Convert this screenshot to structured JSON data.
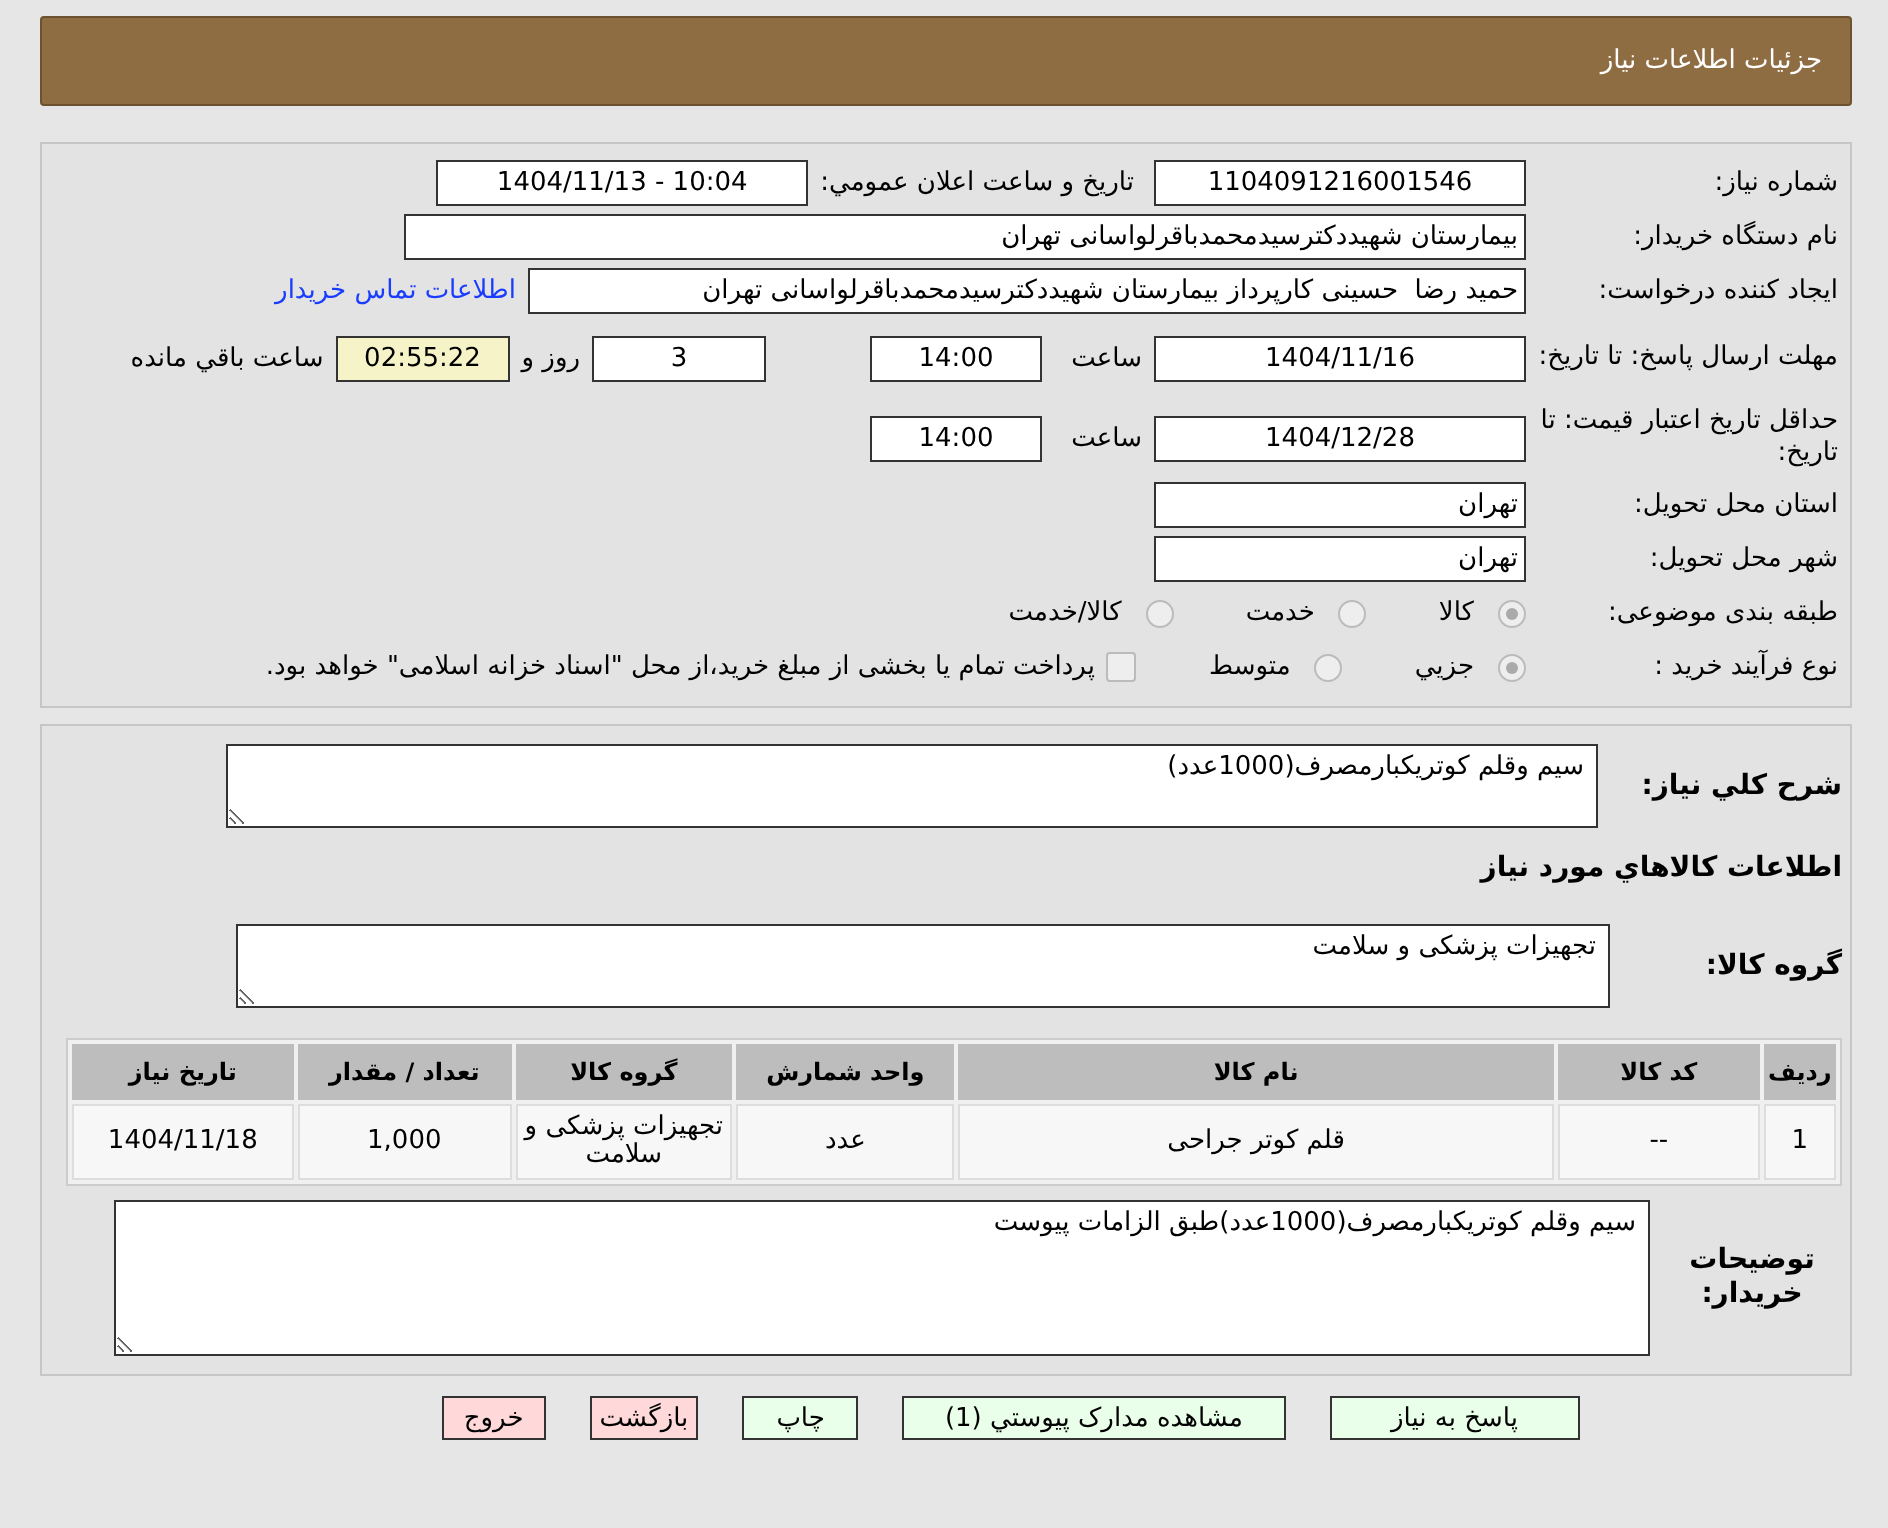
{
  "header": {
    "title": "جزئیات اطلاعات نیاز"
  },
  "need_number": {
    "label": "شماره نیاز:",
    "value": "1104091216001546"
  },
  "announce": {
    "label": "تاریخ و ساعت اعلان عمومي:",
    "value": "1404/11/13 - 10:04"
  },
  "buyer_org": {
    "label": "نام دستگاه خریدار:",
    "value": "بیمارستان شهیددکترسیدمحمدباقرلواسانی تهران"
  },
  "requester": {
    "label": "ایجاد کننده درخواست:",
    "value": "حمید رضا  حسینی کارپرداز بیمارستان شهیددکترسیدمحمدباقرلواسانی تهران",
    "link": "اطلاعات تماس خریدار"
  },
  "deadline": {
    "label": "مهلت ارسال پاسخ: تا تاریخ:",
    "date": "1404/11/16",
    "time_label": "ساعت",
    "time": "14:00",
    "days": "3",
    "days_label": "روز و",
    "remaining": "02:55:22",
    "remaining_label": "ساعت باقي مانده"
  },
  "validity": {
    "label": "حداقل تاریخ اعتبار قیمت: تا تاریخ:",
    "date": "1404/12/28",
    "time_label": "ساعت",
    "time": "14:00"
  },
  "province": {
    "label": "استان محل تحویل:",
    "value": "تهران"
  },
  "city": {
    "label": "شهر محل تحویل:",
    "value": "تهران"
  },
  "category": {
    "label": "طبقه بندی موضوعی:",
    "options": [
      {
        "label": "کالا",
        "selected": true
      },
      {
        "label": "خدمت",
        "selected": false
      },
      {
        "label": "کالا/خدمت",
        "selected": false
      }
    ]
  },
  "process": {
    "label": "نوع فرآیند خرید :",
    "options": [
      {
        "label": "جزيي",
        "selected": true
      },
      {
        "label": "متوسط",
        "selected": false
      }
    ],
    "payment_checkbox": {
      "checked": false,
      "label": "پرداخت تمام یا بخشی از مبلغ خرید،از محل \"اسناد خزانه اسلامی\" خواهد بود."
    }
  },
  "summary": {
    "label": "شرح کلي نیاز:",
    "value": "سیم وقلم کوتریکبارمصرف(1000عدد)"
  },
  "goods_heading": "اطلاعات کالاهاي مورد نیاز",
  "goods_group": {
    "label": "گروه کالا:",
    "value": "تجهیزات پزشکی و سلامت"
  },
  "table": {
    "columns": [
      "ردیف",
      "کد کالا",
      "نام کالا",
      "واحد شمارش",
      "گروه کالا",
      "تعداد / مقدار",
      "تاریخ نیاز"
    ],
    "rows": [
      [
        "1",
        "--",
        "قلم کوتر جراحی",
        "عدد",
        "تجهیزات پزشکی و سلامت",
        "1,000",
        "1404/11/18"
      ]
    ]
  },
  "buyer_notes": {
    "label": "توضیحات خریدار:",
    "value": "سیم وقلم کوتریکبارمصرف(1000عدد)طبق الزامات پیوست"
  },
  "buttons": [
    {
      "label": "پاسخ به نیاز",
      "kind": "primary"
    },
    {
      "label": "مشاهده مدارک پیوستي (1)",
      "kind": "primary"
    },
    {
      "label": "چاپ",
      "kind": "primary"
    },
    {
      "label": "بازگشت",
      "kind": "danger"
    },
    {
      "label": "خروج",
      "kind": "danger"
    }
  ]
}
